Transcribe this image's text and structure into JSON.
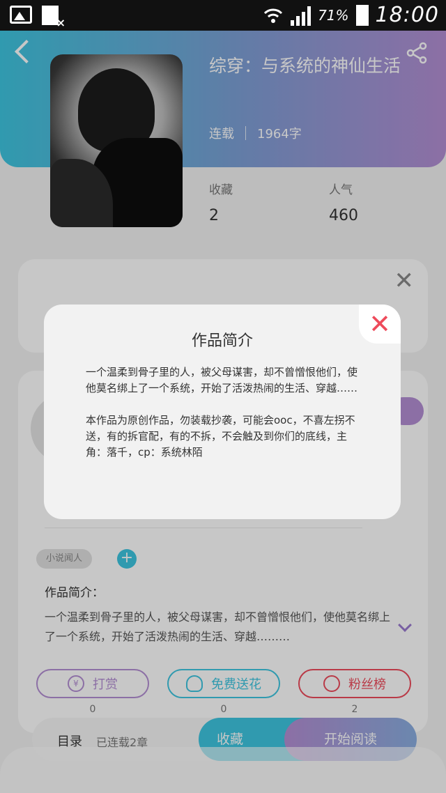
{
  "statusbar": {
    "battery_percent": "71%",
    "time": "18:00"
  },
  "book": {
    "title": "综穿：与系统的神仙生活",
    "status": "连载",
    "word_count": "1964字",
    "stats": [
      {
        "label": "收藏",
        "value": "2"
      },
      {
        "label": "人气",
        "value": "460"
      }
    ]
  },
  "tags": {
    "tag1": "小说闻人",
    "add_symbol": "+"
  },
  "intro": {
    "heading": "作品简介：",
    "text": "一个温柔到骨子里的人，被父母谋害，却不曾憎恨他们，使他莫名绑上了一个系统，开始了活泼热闹的生活、穿越………"
  },
  "actions": [
    {
      "label": "打赏",
      "icon": "yen-icon",
      "count": "0",
      "color": "#b48fd4"
    },
    {
      "label": "免费送花",
      "icon": "flower-icon",
      "count": "0",
      "color": "#3ec6e0"
    },
    {
      "label": "粉丝榜",
      "icon": "fans-icon",
      "count": "2",
      "color": "#ee4b5b"
    }
  ],
  "bottom_bar": {
    "toc_label": "目录",
    "toc_status": "已连载2章",
    "collect_label": "收藏",
    "read_label": "开始阅读"
  },
  "modal": {
    "title": "作品简介",
    "para1": "一个温柔到骨子里的人，被父母谋害，却不曾憎恨他们，使他莫名绑上了一个系统，开始了活泼热闹的生活、穿越……",
    "para2": "本作品为原创作品，勿装载抄袭，可能会ooc，不喜左拐不送，有的拆官配，有的不拆，不会触及到你们的底线，主角：落千，cp：系统林陌",
    "close_symbol": "✕"
  },
  "colors": {
    "accent_cyan": "#3ec6e0",
    "accent_purple": "#b48fd4",
    "accent_red": "#ee4b5b"
  }
}
